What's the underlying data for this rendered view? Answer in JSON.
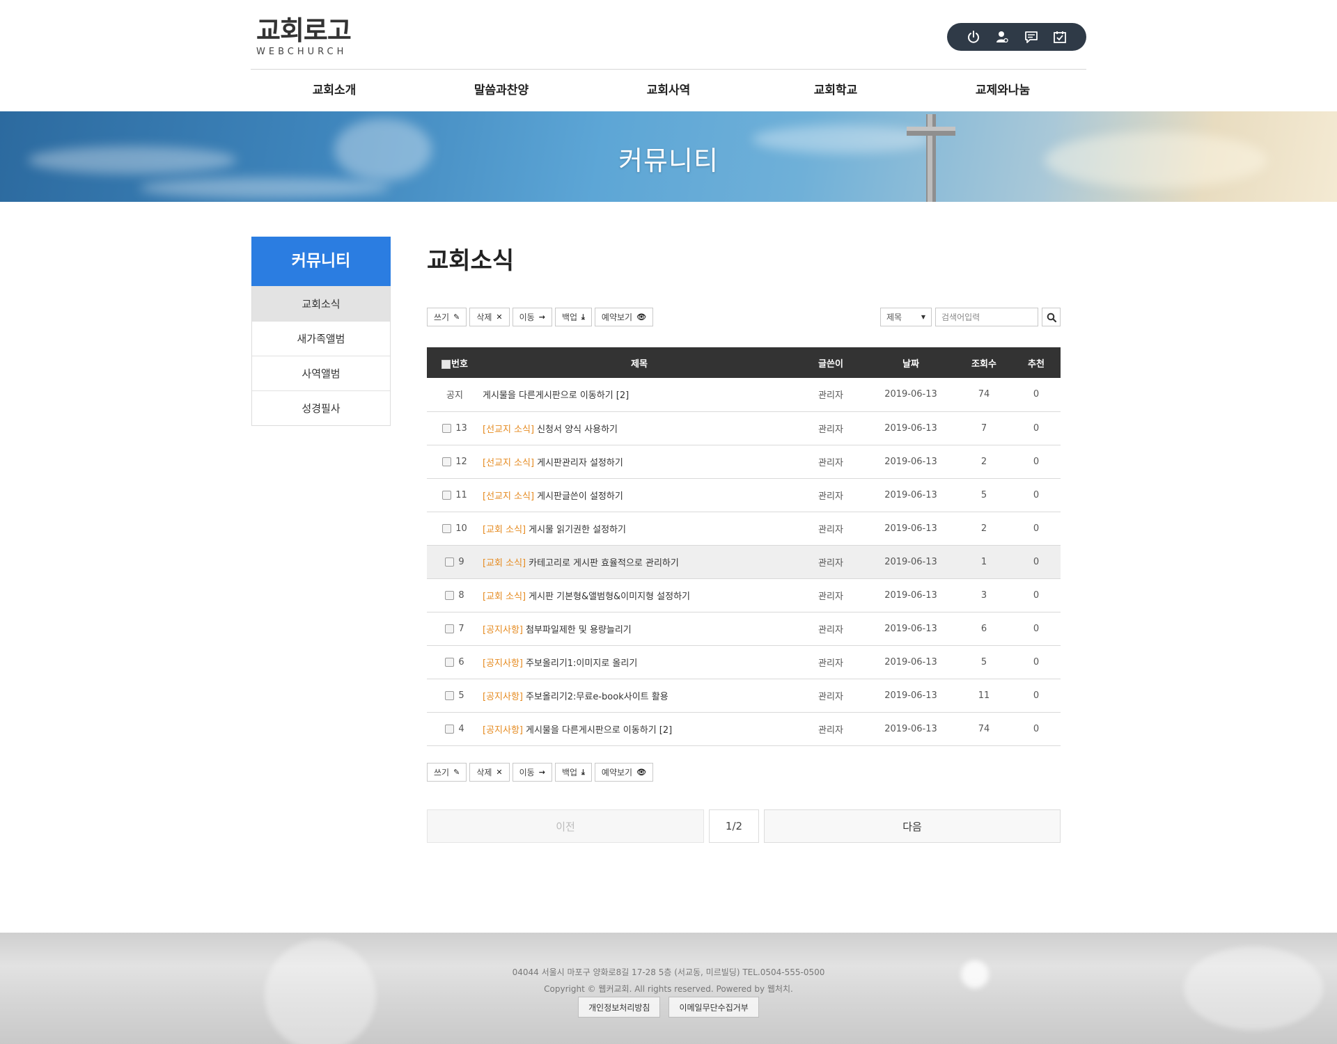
{
  "header": {
    "logo_main": "교회로고",
    "logo_sub": "WEBCHURCH",
    "util_icons": [
      "power-icon",
      "user-icon",
      "message-icon",
      "calendar-check-icon"
    ],
    "nav": [
      "교회소개",
      "말씀과찬양",
      "교회사역",
      "교회학교",
      "교제와나눔"
    ]
  },
  "banner": {
    "title": "커뮤니티"
  },
  "sidebar": {
    "title": "커뮤니티",
    "items": [
      {
        "label": "교회소식",
        "active": true
      },
      {
        "label": "새가족앨범",
        "active": false
      },
      {
        "label": "사역앨범",
        "active": false
      },
      {
        "label": "성경필사",
        "active": false
      }
    ]
  },
  "main": {
    "page_title": "교회소식",
    "toolbar": {
      "write": "쓰기",
      "delete": "삭제",
      "move": "이동",
      "backup": "백업",
      "preview": "예약보기"
    },
    "search": {
      "field_selected": "제목",
      "placeholder": "검색어입력"
    },
    "table": {
      "headers": [
        "번호",
        "제목",
        "글쓴이",
        "날짜",
        "조회수",
        "추천"
      ],
      "rows": [
        {
          "no": "공지",
          "category": "",
          "title": "게시물을 다른게시판으로 이동하기 [2]",
          "author": "관리자",
          "date": "2019-06-13",
          "views": "74",
          "recommend": "0",
          "checkbox": false,
          "highlight": false
        },
        {
          "no": "13",
          "category": "[선교지 소식]",
          "title": "신청서 양식 사용하기",
          "author": "관리자",
          "date": "2019-06-13",
          "views": "7",
          "recommend": "0",
          "checkbox": true,
          "highlight": false
        },
        {
          "no": "12",
          "category": "[선교지 소식]",
          "title": "게시판관리자 설정하기",
          "author": "관리자",
          "date": "2019-06-13",
          "views": "2",
          "recommend": "0",
          "checkbox": true,
          "highlight": false
        },
        {
          "no": "11",
          "category": "[선교지 소식]",
          "title": "게시판글쓴이 설정하기",
          "author": "관리자",
          "date": "2019-06-13",
          "views": "5",
          "recommend": "0",
          "checkbox": true,
          "highlight": false
        },
        {
          "no": "10",
          "category": "[교회 소식]",
          "title": "게시물 읽기권한 설정하기",
          "author": "관리자",
          "date": "2019-06-13",
          "views": "2",
          "recommend": "0",
          "checkbox": true,
          "highlight": false
        },
        {
          "no": "9",
          "category": "[교회 소식]",
          "title": "카테고리로 게시판 효율적으로 관리하기",
          "author": "관리자",
          "date": "2019-06-13",
          "views": "1",
          "recommend": "0",
          "checkbox": true,
          "highlight": true
        },
        {
          "no": "8",
          "category": "[교회 소식]",
          "title": "게시판 기본형&앨범형&이미지형 설정하기",
          "author": "관리자",
          "date": "2019-06-13",
          "views": "3",
          "recommend": "0",
          "checkbox": true,
          "highlight": false
        },
        {
          "no": "7",
          "category": "[공지사항]",
          "title": "첨부파일제한 및 용량늘리기",
          "author": "관리자",
          "date": "2019-06-13",
          "views": "6",
          "recommend": "0",
          "checkbox": true,
          "highlight": false
        },
        {
          "no": "6",
          "category": "[공지사항]",
          "title": "주보올리기1:이미지로 올리기",
          "author": "관리자",
          "date": "2019-06-13",
          "views": "5",
          "recommend": "0",
          "checkbox": true,
          "highlight": false
        },
        {
          "no": "5",
          "category": "[공지사항]",
          "title": "주보올리기2:무료e-book사이트 활용",
          "author": "관리자",
          "date": "2019-06-13",
          "views": "11",
          "recommend": "0",
          "checkbox": true,
          "highlight": false
        },
        {
          "no": "4",
          "category": "[공지사항]",
          "title": "게시물을 다른게시판으로 이동하기 [2]",
          "author": "관리자",
          "date": "2019-06-13",
          "views": "74",
          "recommend": "0",
          "checkbox": true,
          "highlight": false
        }
      ]
    },
    "pager": {
      "prev": "이전",
      "page": "1/2",
      "next": "다음"
    }
  },
  "footer": {
    "address": "04044 서울시 마포구 양화로8길 17-28 5층 (서교동, 미르빌딩) TEL.0504-555-0500",
    "copyright": "Copyright © 웹커교회. All rights reserved. Powered by 웹처치.",
    "links": [
      "개인정보처리방침",
      "이메일무단수집거부"
    ]
  },
  "colors": {
    "accent": "#2b7de1",
    "header_util_bg": "#2f3a47",
    "table_header_bg": "#333333",
    "category": "#e58a1f"
  }
}
